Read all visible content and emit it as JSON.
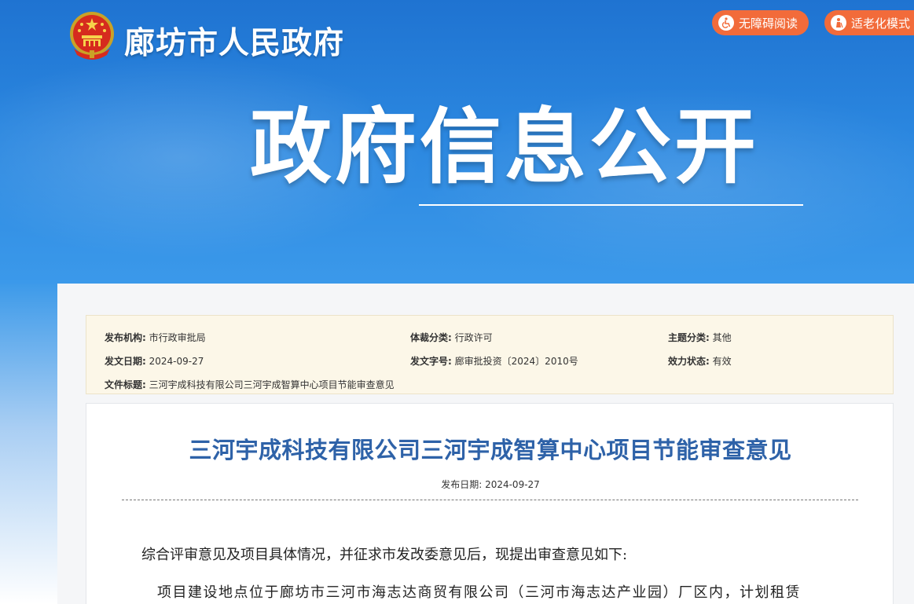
{
  "header": {
    "site_title": "廊坊市人民政府",
    "buttons": [
      {
        "label": "无障碍阅读",
        "icon": "wheelchair-icon"
      },
      {
        "label": "适老化模式",
        "icon": "elder-icon"
      }
    ],
    "section_heading": "政府信息公开"
  },
  "meta": {
    "publisher_label": "发布机构:",
    "publisher_value": "市行政审批局",
    "genre_label": "体裁分类:",
    "genre_value": "行政许可",
    "topic_label": "主题分类:",
    "topic_value": "其他",
    "issue_date_label": "发文日期:",
    "issue_date_value": "2024-09-27",
    "doc_no_label": "发文字号:",
    "doc_no_value": "廊审批投资〔2024〕2010号",
    "status_label": "效力状态:",
    "status_value": "有效",
    "doc_title_label": "文件标题:",
    "doc_title_value": "三河宇成科技有限公司三河宇成智算中心项目节能审查意见"
  },
  "article": {
    "title": "三河宇成科技有限公司三河宇成智算中心项目节能审查意见",
    "date_label": "发布日期:",
    "date_value": "2024-09-27",
    "paragraph_1": "综合评审意见及项目具体情况，并征求市发改委意见后，现提出审查意见如下:",
    "paragraph_2": "项目建设地点位于廊坊市三河市海志达商贸有限公司（三河市海志达产业园）厂区内，计划租赁"
  },
  "colors": {
    "hero_blue": "#2a86df",
    "button_orange": "#f26b3a",
    "title_blue": "#2e62a8",
    "meta_bg": "#fcf7e8"
  }
}
